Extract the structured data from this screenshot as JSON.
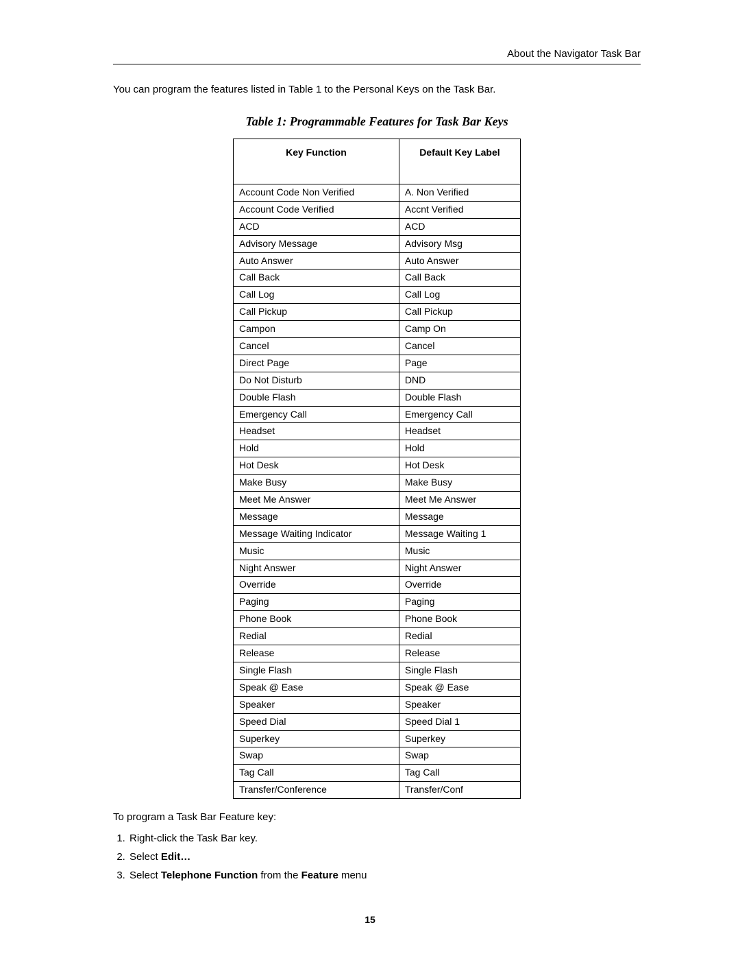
{
  "header": {
    "right": "About the Navigator Task Bar"
  },
  "intro": "You can program the features listed in Table 1 to the Personal Keys on the Task Bar.",
  "caption": "Table 1: Programmable Features for Task Bar Keys",
  "table": {
    "col1": "Key Function",
    "col2": "Default Key Label",
    "rows": [
      {
        "f": "Account Code Non Verified",
        "d": "A. Non Verified"
      },
      {
        "f": "Account Code Verified",
        "d": "Accnt Verified"
      },
      {
        "f": "ACD",
        "d": "ACD"
      },
      {
        "f": "Advisory Message",
        "d": "Advisory Msg"
      },
      {
        "f": "Auto Answer",
        "d": "Auto Answer"
      },
      {
        "f": "Call Back",
        "d": "Call Back"
      },
      {
        "f": "Call Log",
        "d": "Call Log"
      },
      {
        "f": "Call Pickup",
        "d": "Call Pickup"
      },
      {
        "f": "Campon",
        "d": "Camp On"
      },
      {
        "f": "Cancel",
        "d": "Cancel"
      },
      {
        "f": "Direct Page",
        "d": "Page"
      },
      {
        "f": "Do Not Disturb",
        "d": "DND"
      },
      {
        "f": "Double Flash",
        "d": "Double Flash"
      },
      {
        "f": "Emergency Call",
        "d": "Emergency Call"
      },
      {
        "f": "Headset",
        "d": "Headset"
      },
      {
        "f": "Hold",
        "d": "Hold"
      },
      {
        "f": "Hot Desk",
        "d": "Hot Desk"
      },
      {
        "f": "Make Busy",
        "d": "Make Busy"
      },
      {
        "f": "Meet Me Answer",
        "d": "Meet Me Answer"
      },
      {
        "f": "Message",
        "d": "Message"
      },
      {
        "f": "Message Waiting Indicator",
        "d": "Message Waiting 1"
      },
      {
        "f": "Music",
        "d": "Music"
      },
      {
        "f": "Night Answer",
        "d": "Night Answer"
      },
      {
        "f": "Override",
        "d": "Override"
      },
      {
        "f": "Paging",
        "d": "Paging"
      },
      {
        "f": "Phone Book",
        "d": "Phone Book"
      },
      {
        "f": "Redial",
        "d": "Redial"
      },
      {
        "f": "Release",
        "d": "Release"
      },
      {
        "f": "Single Flash",
        "d": "Single Flash"
      },
      {
        "f": "Speak @ Ease",
        "d": "Speak @ Ease"
      },
      {
        "f": "Speaker",
        "d": "Speaker"
      },
      {
        "f": "Speed Dial",
        "d": "Speed Dial 1"
      },
      {
        "f": "Superkey",
        "d": "Superkey"
      },
      {
        "f": "Swap",
        "d": "Swap"
      },
      {
        "f": "Tag Call",
        "d": "Tag Call"
      },
      {
        "f": "Transfer/Conference",
        "d": "Transfer/Conf"
      }
    ]
  },
  "instr_lead": "To program a Task Bar Feature key:",
  "steps": {
    "s1": "Right-click the Task Bar key.",
    "s2a": "Select ",
    "s2b": "Edit…",
    "s3a": "Select ",
    "s3b": "Telephone Function",
    "s3c": " from the ",
    "s3d": "Feature",
    "s3e": " menu"
  },
  "page_number": "15"
}
